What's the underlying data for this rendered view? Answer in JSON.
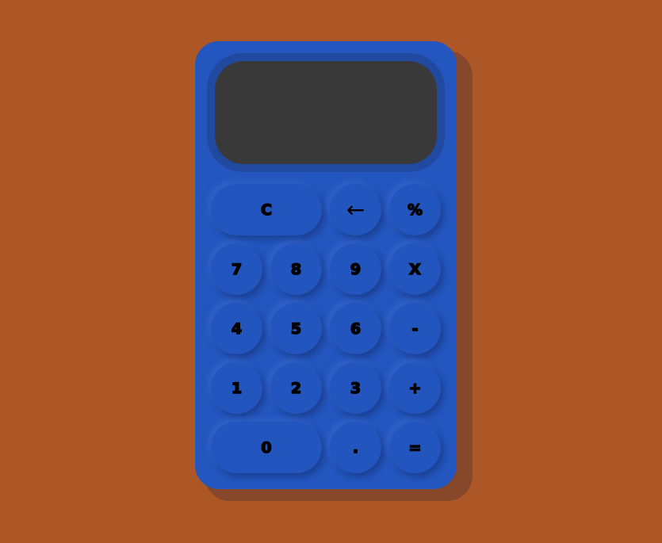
{
  "display": {
    "value": ""
  },
  "buttons": [
    {
      "label": "C",
      "name": "clear-button",
      "col": 0,
      "row": 0,
      "wide": true
    },
    {
      "label": "←",
      "name": "backspace-button",
      "col": 2,
      "row": 0
    },
    {
      "label": "%",
      "name": "percent-button",
      "col": 3,
      "row": 0
    },
    {
      "label": "7",
      "name": "digit-7-button",
      "col": 0,
      "row": 1
    },
    {
      "label": "8",
      "name": "digit-8-button",
      "col": 1,
      "row": 1
    },
    {
      "label": "9",
      "name": "digit-9-button",
      "col": 2,
      "row": 1
    },
    {
      "label": "X",
      "name": "multiply-button",
      "col": 3,
      "row": 1
    },
    {
      "label": "4",
      "name": "digit-4-button",
      "col": 0,
      "row": 2
    },
    {
      "label": "5",
      "name": "digit-5-button",
      "col": 1,
      "row": 2
    },
    {
      "label": "6",
      "name": "digit-6-button",
      "col": 2,
      "row": 2
    },
    {
      "label": "-",
      "name": "subtract-button",
      "col": 3,
      "row": 2
    },
    {
      "label": "1",
      "name": "digit-1-button",
      "col": 0,
      "row": 3
    },
    {
      "label": "2",
      "name": "digit-2-button",
      "col": 1,
      "row": 3
    },
    {
      "label": "3",
      "name": "digit-3-button",
      "col": 2,
      "row": 3
    },
    {
      "label": "+",
      "name": "add-button",
      "col": 3,
      "row": 3
    },
    {
      "label": "0",
      "name": "digit-0-button",
      "col": 0,
      "row": 4,
      "wide": true
    },
    {
      "label": ".",
      "name": "decimal-button",
      "col": 2,
      "row": 4
    },
    {
      "label": "=",
      "name": "equals-button",
      "col": 3,
      "row": 4
    }
  ]
}
